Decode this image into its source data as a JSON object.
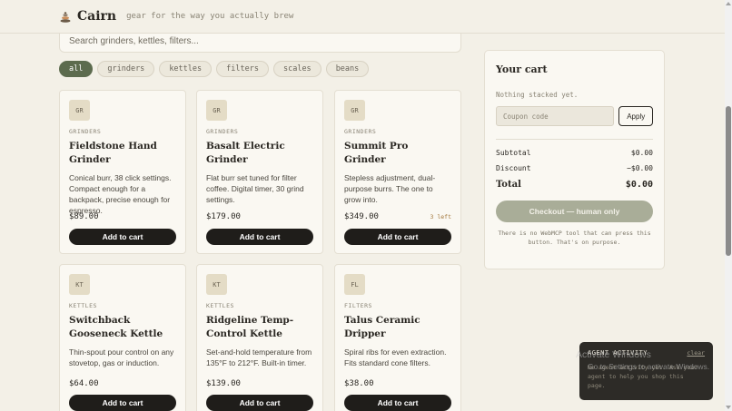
{
  "header": {
    "brand": "Cairn",
    "tagline": "gear for the way you actually brew"
  },
  "search": {
    "placeholder": "Search grinders, kettles, filters..."
  },
  "filters": [
    "all",
    "grinders",
    "kettles",
    "filters",
    "scales",
    "beans"
  ],
  "products": [
    {
      "badge": "GR",
      "category": "GRINDERS",
      "name": "Fieldstone Hand Grinder",
      "description": "Conical burr, 38 click settings. Compact enough for a backpack, precise enough for espresso.",
      "price": "$89.00",
      "stock": "",
      "button": "Add to cart"
    },
    {
      "badge": "GR",
      "category": "GRINDERS",
      "name": "Basalt Electric Grinder",
      "description": "Flat burr set tuned for filter coffee. Digital timer, 30 grind settings.",
      "price": "$179.00",
      "stock": "",
      "button": "Add to cart"
    },
    {
      "badge": "GR",
      "category": "GRINDERS",
      "name": "Summit Pro Grinder",
      "description": "Stepless adjustment, dual-purpose burrs. The one to grow into.",
      "price": "$349.00",
      "stock": "3 left",
      "button": "Add to cart"
    },
    {
      "badge": "KT",
      "category": "KETTLES",
      "name": "Switchback Gooseneck Kettle",
      "description": "Thin-spout pour control on any stovetop, gas or induction.",
      "price": "$64.00",
      "stock": "",
      "button": "Add to cart"
    },
    {
      "badge": "KT",
      "category": "KETTLES",
      "name": "Ridgeline Temp-Control Kettle",
      "description": "Set-and-hold temperature from 135°F to 212°F. Built-in timer.",
      "price": "$139.00",
      "stock": "",
      "button": "Add to cart"
    },
    {
      "badge": "FL",
      "category": "FILTERS",
      "name": "Talus Ceramic Dripper",
      "description": "Spiral ribs for even extraction. Fits standard cone filters.",
      "price": "$38.00",
      "stock": "",
      "button": "Add to cart"
    }
  ],
  "cart": {
    "title": "Your cart",
    "empty_text": "Nothing stacked yet.",
    "coupon_placeholder": "Coupon code",
    "apply_label": "Apply",
    "subtotal_label": "Subtotal",
    "subtotal_value": "$0.00",
    "discount_label": "Discount",
    "discount_value": "−$0.00",
    "total_label": "Total",
    "total_value": "$0.00",
    "checkout_label": "Checkout — human only",
    "checkout_note": "There is no WebMCP tool that can press this button. That's on purpose."
  },
  "agent_panel": {
    "title": "AGENT ACTIVITY",
    "clear_label": "clear",
    "body": "No agent activity yet. Ask your agent to help you shop this page."
  },
  "windows_watermark": {
    "title": "Activate Windows",
    "subtitle": "Go to Settings to activate Windows."
  },
  "colors": {
    "background": "#f3f0e7",
    "accent_green": "#5c6b4e",
    "button_dark": "#1f1d1a",
    "checkout_disabled": "#a9ad98",
    "stock_warning": "#a3763a"
  }
}
